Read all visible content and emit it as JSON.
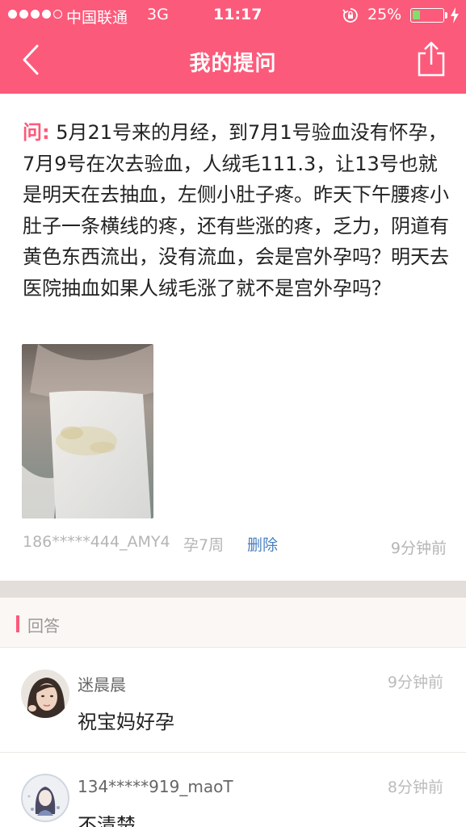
{
  "status_bar": {
    "carrier": "中国联通",
    "network": "3G",
    "time": "11:17",
    "battery": "25%"
  },
  "nav": {
    "title": "我的提问",
    "back_icon": "chevron-left-icon",
    "share_icon": "share-icon"
  },
  "question": {
    "label": "问:",
    "text": "5月21号来的月经，到7月1号验血没有怀孕，7月9号在次去验血，人绒毛111.3，让13号也就是明天在去抽血，左侧小肚子疼。昨天下午腰疼小肚子一条横线的疼，还有些涨的疼，乏力，阴道有黄色东西流出，没有流血，会是宫外孕吗？明天去医院抽血如果人绒毛涨了就不是宫外孕吗？",
    "user": "186*****444_AMY4",
    "week": "孕7周",
    "delete_label": "删除",
    "time": "9分钟前"
  },
  "answers": {
    "title": "回答",
    "items": [
      {
        "name": "迷晨晨",
        "time": "9分钟前",
        "text": "祝宝妈好孕"
      },
      {
        "name": "134*****919_maoT",
        "time": "8分钟前",
        "text": "不清楚。。"
      }
    ]
  },
  "colors": {
    "accent": "#fc5a7a",
    "link": "#4a7fc1",
    "separator": "#e3ded9"
  }
}
